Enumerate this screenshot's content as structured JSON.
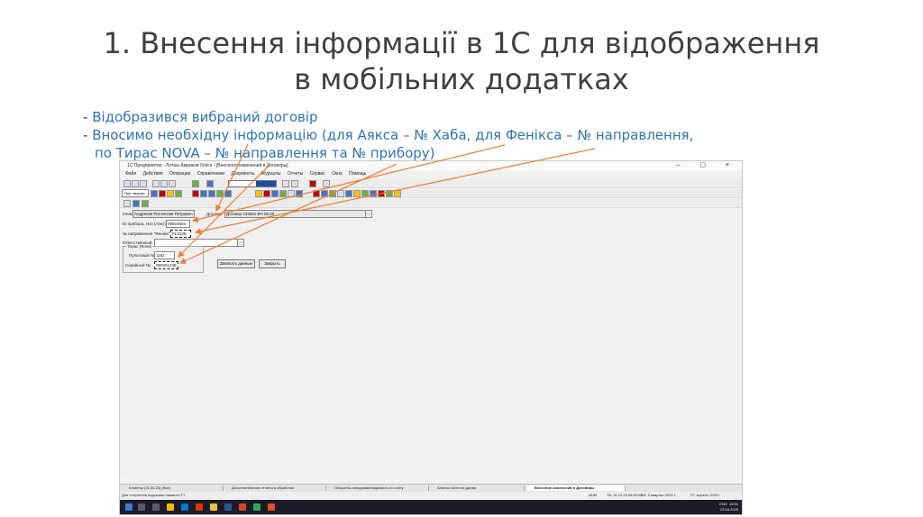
{
  "slide": {
    "title_line1": "1. Внесення інформації в 1С для відображення",
    "title_line2": "в мобільних додатках",
    "bullets": [
      "Відобразився вибраний договір",
      "Вносимо необхідну інформацію (для Аякса – № Хаба, для Фенікса – № направлення,",
      "по Тирас NOVA – № направлення та № прибору)"
    ],
    "bullet_marker": "-",
    "accent_color": "#2e74b5",
    "arrow_color": "#ed7d31"
  },
  "app": {
    "window_title": "1С:Предприятие - Лоташ Амриков /Volce - [Внесення изменений в Договоры]",
    "window_controls": "– ▢ ×",
    "menu": [
      "Файл",
      "Действия",
      "Операции",
      "Справочники",
      "Документы",
      "Журналы",
      "Отчеты",
      "Сервис",
      "Окна",
      "Помощь"
    ],
    "toolbar_box": "Пер. версии",
    "form": {
      "client_label": "Клиент:",
      "client_value": "Андреєва Ростислав Петрович",
      "contract_label": "Договор:",
      "contract_value": "Договор 134821 ВП 06.20",
      "id_label": "ID прибора, HOI (Аякс):",
      "id_value": "09024004",
      "napr_label": "№ направления \"Феникс\":",
      "napr_value": "FL3136",
      "resp_label": "Ответственный:",
      "resp_value": "",
      "group_label": "Тирас (Nova)",
      "pult_label": "Пультовый №:",
      "pult_value": "1152",
      "serial_label": "Серийный №:",
      "serial_value": "080261248",
      "write_button": "Записать данные",
      "close_button": "Закрыть",
      "dropdown_glyph": "…"
    },
    "tabs": [
      "Клиенты (01.04.25) (Все)",
      "Дополнительные отчеты и обработки",
      "Оборотно-сальдовая ведомость по счету",
      "Анализ счета по датам",
      "Внесение изменений в Договоры"
    ],
    "status": {
      "hint": "Для получения подсказки нажмите F1",
      "num": "NUM",
      "ta": "ТА: 31.12.23  06:00:00",
      "ba": "БИ: 2 квартал 2025 г.",
      "tp": "ТП: Апрель 2025 г."
    },
    "taskbar": {
      "lang": "ENG",
      "time": "13:51",
      "date": "23.04.2025"
    }
  }
}
